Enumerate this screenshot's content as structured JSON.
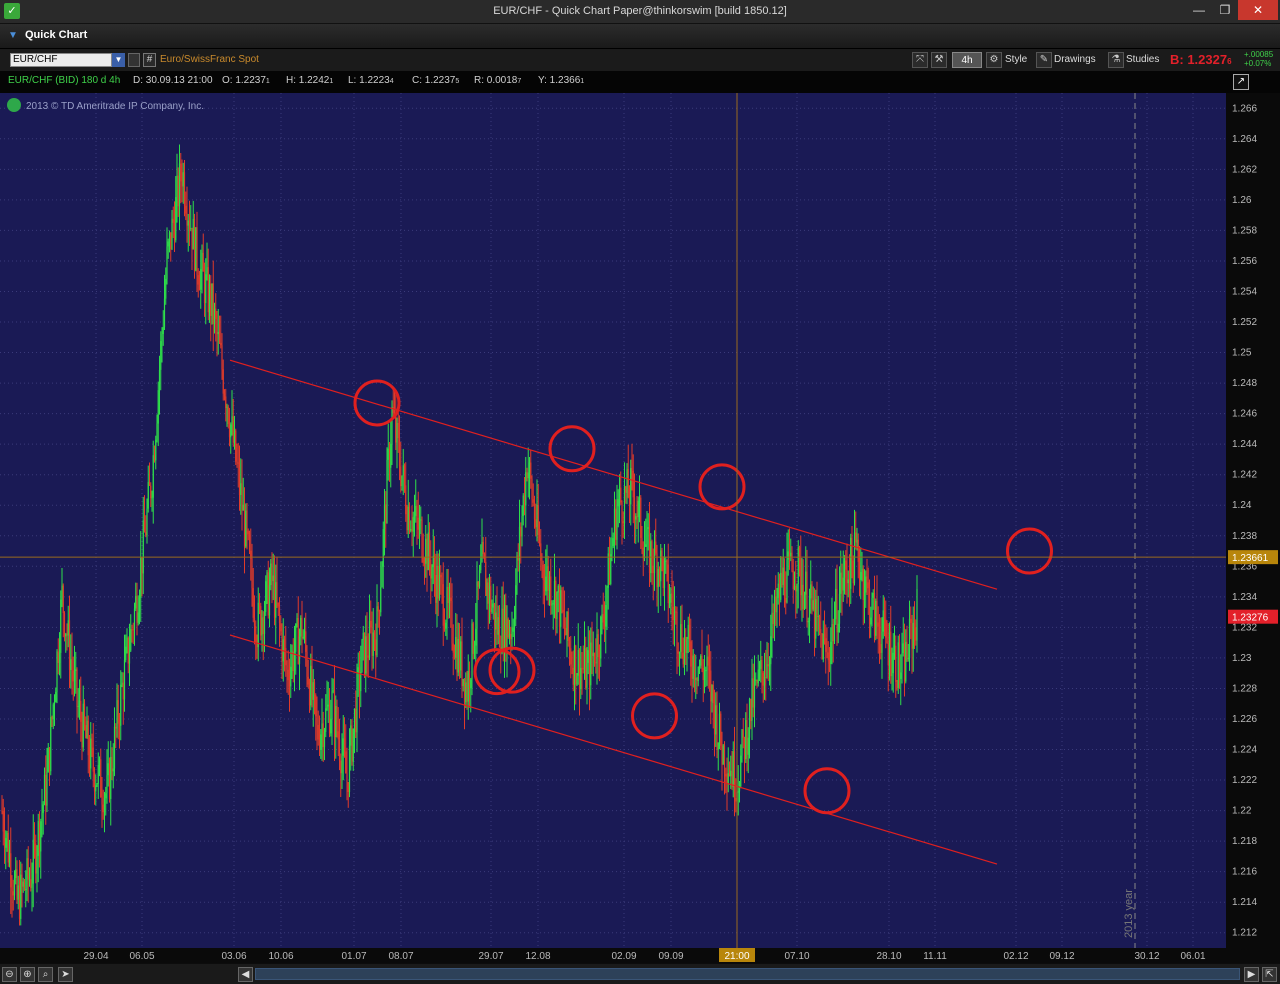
{
  "window": {
    "title": "EUR/CHF - Quick Chart Paper@thinkorswim [build 1850.12]",
    "minimize": "—",
    "maximize": "❐",
    "close": "✕"
  },
  "panel": {
    "title": "Quick Chart"
  },
  "toolbar": {
    "symbol": "EUR/CHF",
    "description": "Euro/SwissFranc Spot",
    "hash": "#",
    "aggregation": "4h",
    "style_label": "Style",
    "drawings_label": "Drawings",
    "studies_label": "Studies",
    "bid_label": "B: 1.2327",
    "bid_sub": "6",
    "change_abs": "+.00085",
    "change_pct": "+0.07%"
  },
  "header": {
    "symbol": "EUR/CHF (BID) 180 d 4h",
    "date": "D: 30.09.13 21:00",
    "open": "O: 1.2237",
    "open_sub": "1",
    "high": "H: 1.2242",
    "high_sub": "1",
    "low": "L: 1.2223",
    "low_sub": "4",
    "close": "C: 1.2237",
    "close_sub": "5",
    "range": "R: 0.0018",
    "range_sub": "7",
    "y": "Y: 1.2366",
    "y_sub": "1",
    "copyright": "2013 © TD Ameritrade IP Company, Inc."
  },
  "colors": {
    "chart_bg": "#1a1a55",
    "up": "#2ee04a",
    "down": "#e03b2a",
    "channel": "#e0201f",
    "crosshair": "#9a6a1e",
    "grid": "#3a3a7a"
  },
  "chart_data": {
    "type": "candlestick",
    "timeframe": "4h",
    "range": "180 d",
    "ylim": [
      1.211,
      1.267
    ],
    "y_ticks": [
      "1.266",
      "1.264",
      "1.262",
      "1.26",
      "1.258",
      "1.256",
      "1.254",
      "1.252",
      "1.25",
      "1.248",
      "1.246",
      "1.244",
      "1.242",
      "1.24",
      "1.238",
      "1.236",
      "1.234",
      "1.232",
      "1.23",
      "1.228",
      "1.226",
      "1.224",
      "1.222",
      "1.22",
      "1.218",
      "1.216",
      "1.214",
      "1.212"
    ],
    "x_ticks": [
      "29.04",
      "06.05",
      "03.06",
      "10.06",
      "01.07",
      "08.07",
      "29.07",
      "12.08",
      "02.09",
      "09.09",
      "07.10",
      "28.10",
      "11.11",
      "02.12",
      "09.12",
      "30.12",
      "06.01"
    ],
    "crosshair": {
      "x_label": "21:00",
      "y_label": "1.2366",
      "y_sub": "1"
    },
    "last_price": {
      "label": "1.2327",
      "sub": "6",
      "value": 1.2327
    },
    "year_marker": "2013 year",
    "price_path": [
      [
        0,
        1.22
      ],
      [
        2,
        1.214
      ],
      [
        4,
        1.216
      ],
      [
        6,
        1.222
      ],
      [
        8,
        1.234
      ],
      [
        10,
        1.227
      ],
      [
        12,
        1.223
      ],
      [
        14,
        1.221
      ],
      [
        16,
        1.228
      ],
      [
        18,
        1.234
      ],
      [
        20,
        1.242
      ],
      [
        22,
        1.256
      ],
      [
        24,
        1.262
      ],
      [
        26,
        1.256
      ],
      [
        28,
        1.253
      ],
      [
        30,
        1.247
      ],
      [
        32,
        1.24
      ],
      [
        34,
        1.232
      ],
      [
        36,
        1.235
      ],
      [
        38,
        1.229
      ],
      [
        40,
        1.232
      ],
      [
        42,
        1.225
      ],
      [
        44,
        1.227
      ],
      [
        46,
        1.222
      ],
      [
        48,
        1.23
      ],
      [
        50,
        1.232
      ],
      [
        52,
        1.246
      ],
      [
        54,
        1.24
      ],
      [
        56,
        1.238
      ],
      [
        58,
        1.235
      ],
      [
        60,
        1.232
      ],
      [
        62,
        1.228
      ],
      [
        64,
        1.236
      ],
      [
        66,
        1.232
      ],
      [
        68,
        1.232
      ],
      [
        70,
        1.243
      ],
      [
        72,
        1.236
      ],
      [
        74,
        1.234
      ],
      [
        76,
        1.23
      ],
      [
        78,
        1.229
      ],
      [
        80,
        1.232
      ],
      [
        82,
        1.24
      ],
      [
        84,
        1.241
      ],
      [
        86,
        1.237
      ],
      [
        88,
        1.236
      ],
      [
        90,
        1.232
      ],
      [
        92,
        1.23
      ],
      [
        94,
        1.229
      ],
      [
        96,
        1.224
      ],
      [
        98,
        1.222
      ],
      [
        100,
        1.227
      ],
      [
        102,
        1.23
      ],
      [
        104,
        1.235
      ],
      [
        106,
        1.236
      ],
      [
        108,
        1.233
      ],
      [
        110,
        1.23
      ],
      [
        112,
        1.235
      ],
      [
        114,
        1.237
      ],
      [
        116,
        1.233
      ],
      [
        118,
        1.231
      ],
      [
        120,
        1.229
      ],
      [
        122,
        1.233
      ]
    ],
    "channel_upper": {
      "start": [
        0,
        1.2495
      ],
      "end": [
        130,
        1.2345
      ],
      "end_x_tick": "02.12"
    },
    "channel_lower": {
      "start": [
        0,
        1.2315
      ],
      "end": [
        130,
        1.2165
      ],
      "end_x_tick": "02.12"
    },
    "markers": [
      {
        "label": "upper-touch-1",
        "x": 24,
        "y": 1.2467
      },
      {
        "label": "upper-touch-2",
        "x": 50,
        "y": 1.2437
      },
      {
        "label": "upper-touch-3",
        "x": 70,
        "y": 1.2412
      },
      {
        "label": "upper-touch-4",
        "x": 111,
        "y": 1.237
      },
      {
        "label": "lower-touch-1",
        "x": 40,
        "y": 1.2291
      },
      {
        "label": "lower-touch-2",
        "x": 42,
        "y": 1.2292
      },
      {
        "label": "lower-touch-3",
        "x": 61,
        "y": 1.2262
      },
      {
        "label": "lower-touch-4",
        "x": 84,
        "y": 1.2213
      }
    ]
  }
}
